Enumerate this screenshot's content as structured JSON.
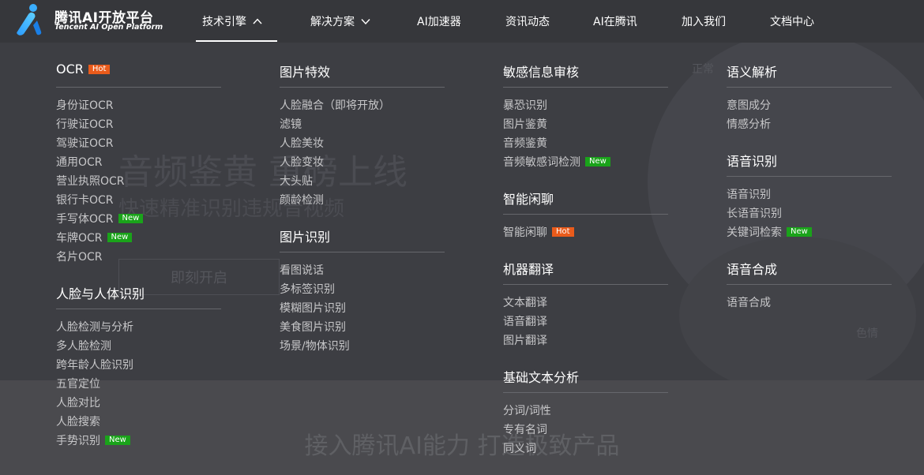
{
  "logo": {
    "name": "腾讯AI开放平台",
    "sub": "Tencent AI Open Platform"
  },
  "nav": [
    {
      "label": "技术引擎",
      "has_chevron": true,
      "active": true
    },
    {
      "label": "解决方案",
      "has_chevron": true,
      "active": false
    },
    {
      "label": "AI加速器",
      "has_chevron": false,
      "active": false
    },
    {
      "label": "资讯动态",
      "has_chevron": false,
      "active": false
    },
    {
      "label": "AI在腾讯",
      "has_chevron": false,
      "active": false
    },
    {
      "label": "加入我们",
      "has_chevron": false,
      "active": false
    },
    {
      "label": "文档中心",
      "has_chevron": false,
      "active": false
    }
  ],
  "background": {
    "hero_title": "音频鉴黄 重磅上线",
    "hero_sub": "快速精准识别违规音视频",
    "hero_button": "即刻开启",
    "slogan": "接入腾讯AI能力 打造极致产品",
    "tags": [
      "正常",
      "色情"
    ]
  },
  "badges": {
    "hot": "Hot",
    "new": "New"
  },
  "colors": {
    "hot": "#ea5b1b",
    "new": "#1aa31a",
    "nav_bg": "#36373b",
    "overlay": "#3d3e43"
  },
  "menu": {
    "col1": {
      "ocr": {
        "title": "OCR",
        "title_badge": "hot",
        "items": [
          {
            "label": "身份证OCR"
          },
          {
            "label": "行驶证OCR"
          },
          {
            "label": "驾驶证OCR"
          },
          {
            "label": "通用OCR"
          },
          {
            "label": "营业执照OCR"
          },
          {
            "label": "银行卡OCR"
          },
          {
            "label": "手写体OCR",
            "badge": "new"
          },
          {
            "label": "车牌OCR",
            "badge": "new"
          },
          {
            "label": "名片OCR"
          }
        ]
      },
      "face": {
        "title": "人脸与人体识别",
        "items": [
          {
            "label": "人脸检测与分析"
          },
          {
            "label": "多人脸检测"
          },
          {
            "label": "跨年龄人脸识别"
          },
          {
            "label": "五官定位"
          },
          {
            "label": "人脸对比"
          },
          {
            "label": "人脸搜索"
          },
          {
            "label": "手势识别",
            "badge": "new"
          }
        ]
      }
    },
    "col2": {
      "effects": {
        "title": "图片特效",
        "items": [
          {
            "label": "人脸融合（即将开放）"
          },
          {
            "label": "滤镜"
          },
          {
            "label": "人脸美妆"
          },
          {
            "label": "人脸变妆"
          },
          {
            "label": "大头贴"
          },
          {
            "label": "颜龄检测"
          }
        ]
      },
      "image_rec": {
        "title": "图片识别",
        "items": [
          {
            "label": "看图说话"
          },
          {
            "label": "多标签识别"
          },
          {
            "label": "模糊图片识别"
          },
          {
            "label": "美食图片识别"
          },
          {
            "label": "场景/物体识别"
          }
        ]
      }
    },
    "col3": {
      "sensitive": {
        "title": "敏感信息审核",
        "items": [
          {
            "label": "暴恐识别"
          },
          {
            "label": "图片鉴黄"
          },
          {
            "label": "音频鉴黄"
          },
          {
            "label": "音频敏感词检测",
            "badge": "new"
          }
        ]
      },
      "chat": {
        "title": "智能闲聊",
        "items": [
          {
            "label": "智能闲聊",
            "badge": "hot"
          }
        ]
      },
      "translate": {
        "title": "机器翻译",
        "items": [
          {
            "label": "文本翻译"
          },
          {
            "label": "语音翻译"
          },
          {
            "label": "图片翻译"
          }
        ]
      },
      "text": {
        "title": "基础文本分析",
        "items": [
          {
            "label": "分词/词性"
          },
          {
            "label": "专有名词"
          },
          {
            "label": "同义词"
          }
        ]
      }
    },
    "col4": {
      "semantic": {
        "title": "语义解析",
        "items": [
          {
            "label": "意图成分"
          },
          {
            "label": "情感分析"
          }
        ]
      },
      "asr": {
        "title": "语音识别",
        "items": [
          {
            "label": "语音识别"
          },
          {
            "label": "长语音识别"
          },
          {
            "label": "关键词检索",
            "badge": "new"
          }
        ]
      },
      "tts": {
        "title": "语音合成",
        "items": [
          {
            "label": "语音合成"
          }
        ]
      }
    }
  }
}
